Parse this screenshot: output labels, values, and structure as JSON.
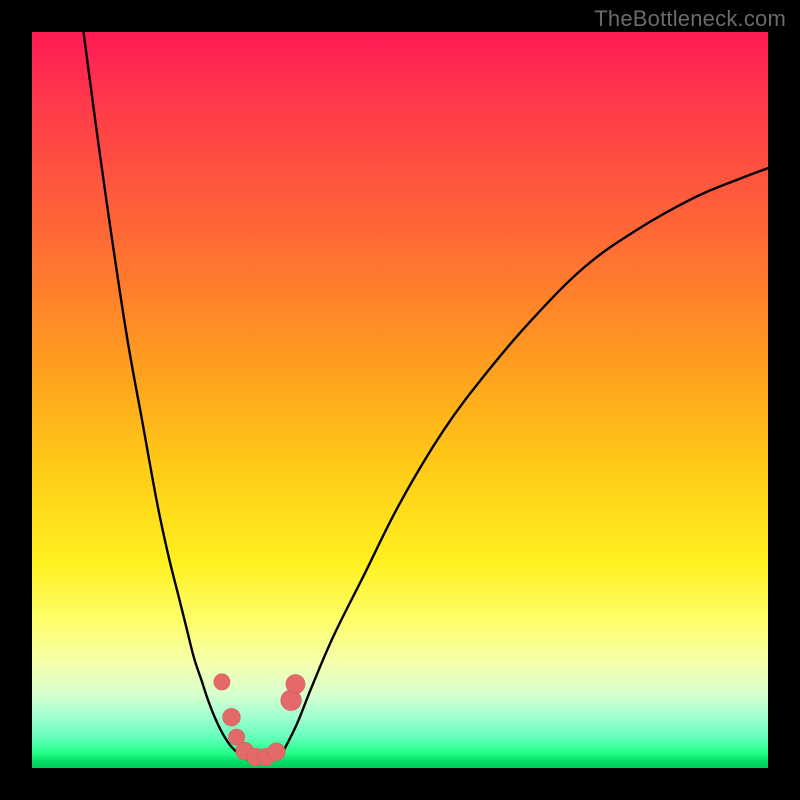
{
  "watermark": {
    "text": "TheBottleneck.com"
  },
  "colors": {
    "frame": "#000000",
    "curve_stroke": "#000000",
    "marker_fill": "#e46a6a",
    "marker_stroke": "#d85a5a"
  },
  "chart_data": {
    "type": "line",
    "title": "",
    "xlabel": "",
    "ylabel": "",
    "xlim": [
      0,
      100
    ],
    "ylim": [
      0,
      100
    ],
    "grid": false,
    "legend": false,
    "series": [
      {
        "name": "left-branch",
        "x": [
          7.0,
          9.0,
          11.0,
          13.0,
          15.0,
          17.0,
          18.5,
          20.0,
          21.0,
          22.0,
          23.0,
          24.0,
          25.0,
          26.0,
          27.0,
          28.0
        ],
        "y": [
          100.0,
          85.0,
          71.0,
          58.0,
          47.0,
          36.0,
          29.0,
          23.0,
          19.0,
          15.0,
          12.0,
          9.0,
          6.5,
          4.5,
          3.0,
          2.0
        ]
      },
      {
        "name": "valley-floor",
        "x": [
          28.0,
          29.0,
          30.0,
          31.0,
          32.0,
          33.0,
          34.0
        ],
        "y": [
          2.0,
          1.3,
          1.0,
          0.9,
          1.0,
          1.3,
          2.0
        ]
      },
      {
        "name": "right-branch",
        "x": [
          34.0,
          36.0,
          38.0,
          41.0,
          45.0,
          50.0,
          56.0,
          62.0,
          68.0,
          75.0,
          82.0,
          90.0,
          96.0,
          100.0
        ],
        "y": [
          2.0,
          6.0,
          11.0,
          18.0,
          26.0,
          36.0,
          46.0,
          54.0,
          61.0,
          68.0,
          73.0,
          77.5,
          80.0,
          81.5
        ]
      }
    ],
    "markers": [
      {
        "x": 25.8,
        "y": 11.7,
        "r": 1.1
      },
      {
        "x": 27.1,
        "y": 6.9,
        "r": 1.2
      },
      {
        "x": 27.8,
        "y": 4.2,
        "r": 1.1
      },
      {
        "x": 28.9,
        "y": 2.3,
        "r": 1.2
      },
      {
        "x": 30.4,
        "y": 1.5,
        "r": 1.2
      },
      {
        "x": 31.8,
        "y": 1.5,
        "r": 1.2
      },
      {
        "x": 33.2,
        "y": 2.2,
        "r": 1.2
      },
      {
        "x": 35.2,
        "y": 9.2,
        "r": 1.4
      },
      {
        "x": 35.8,
        "y": 11.4,
        "r": 1.3
      }
    ]
  }
}
